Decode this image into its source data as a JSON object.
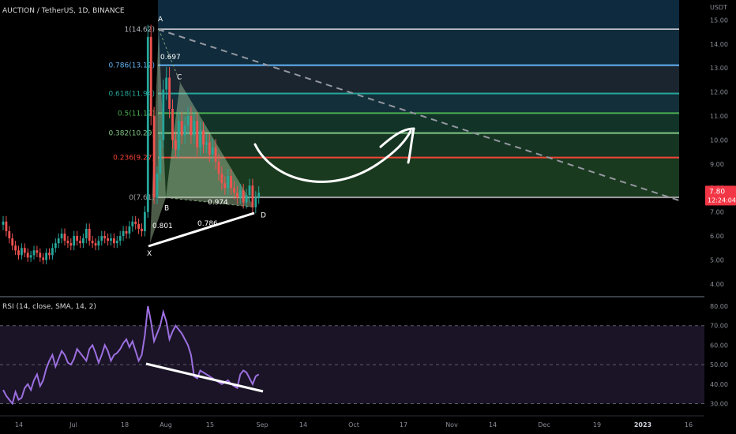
{
  "header": {
    "symbol": "AUCTION / TetherUS, 1D, BINANCE"
  },
  "rsi_header": "RSI (14, close, SMA, 14, 2)",
  "price_axis": {
    "unit": "USDT",
    "ticks": [
      "15.00",
      "14.00",
      "13.00",
      "12.00",
      "11.00",
      "10.00",
      "9.00",
      "8.00",
      "7.00",
      "6.00",
      "5.00",
      "4.00"
    ],
    "current_price": "7.80",
    "countdown": "12:24:04"
  },
  "rsi_axis": {
    "ticks": [
      "80.00",
      "70.00",
      "60.00",
      "50.00",
      "40.00",
      "30.00"
    ]
  },
  "time_axis": {
    "ticks": [
      "14",
      "Jul",
      "18",
      "Aug",
      "15",
      "Sep",
      "14",
      "Oct",
      "17",
      "Nov",
      "14",
      "Dec",
      "19",
      "2023",
      "16"
    ]
  },
  "fib_levels": [
    {
      "label": "1(14.62)",
      "color": "#b2b5be"
    },
    {
      "label": "0.786(13.12)",
      "color": "#64b5f6"
    },
    {
      "label": "0.618(11.94)",
      "color": "#26a69a"
    },
    {
      "label": "0.5(11.12)",
      "color": "#4caf50"
    },
    {
      "label": "0.382(10.29)",
      "color": "#81c784"
    },
    {
      "label": "0.236(9.27)",
      "color": "#f44336"
    },
    {
      "label": "0(7.61)",
      "color": "#9e9e9e"
    }
  ],
  "pattern": {
    "points": [
      "X",
      "A",
      "B",
      "C",
      "D"
    ],
    "ratios": [
      "0.697",
      "0.801",
      "0.974",
      "0.786"
    ]
  },
  "colors": {
    "up": "#26a69a",
    "down": "#ef5350",
    "rsi_line": "#9c6fe0",
    "price_tag": "#f23645",
    "pattern_fill": "#a9c99f"
  },
  "chart_data": {
    "type": "candlestick",
    "title": "AUCTION / TetherUS, 1D, BINANCE",
    "ylabel": "USDT",
    "ylim": [
      3.8,
      15.5
    ],
    "fibonacci": [
      {
        "ratio": 1,
        "price": 14.62
      },
      {
        "ratio": 0.786,
        "price": 13.12
      },
      {
        "ratio": 0.618,
        "price": 11.94
      },
      {
        "ratio": 0.5,
        "price": 11.12
      },
      {
        "ratio": 0.382,
        "price": 10.29
      },
      {
        "ratio": 0.236,
        "price": 9.27
      },
      {
        "ratio": 0,
        "price": 7.61
      }
    ],
    "harmonic_points": [
      {
        "name": "X",
        "price": 5.7
      },
      {
        "name": "A",
        "price": 14.62
      },
      {
        "name": "B",
        "price": 7.6
      },
      {
        "name": "C",
        "price": 12.4
      },
      {
        "name": "D",
        "price": 7.2
      }
    ],
    "last_price": 7.8,
    "close": [
      6.6,
      6.2,
      5.9,
      5.6,
      5.4,
      5.2,
      5.5,
      5.3,
      5.1,
      5.2,
      5.4,
      5.3,
      5.1,
      5.0,
      5.3,
      5.2,
      5.5,
      5.7,
      5.9,
      6.1,
      5.8,
      5.7,
      5.6,
      6.0,
      5.8,
      5.7,
      5.9,
      6.3,
      5.8,
      5.7,
      5.6,
      5.8,
      6.0,
      5.9,
      5.8,
      5.9,
      5.7,
      5.8,
      6.0,
      6.2,
      6.1,
      6.4,
      6.6,
      6.5,
      6.3,
      6.2,
      7.0,
      14.3,
      11.0,
      7.6,
      8.6,
      10.0,
      12.1,
      12.6,
      11.3,
      10.0,
      9.6,
      10.8,
      10.2,
      10.6,
      11.0,
      10.2,
      10.8,
      9.7,
      10.4,
      9.8,
      9.9,
      9.4,
      9.7,
      9.1,
      8.6,
      8.2,
      8.0,
      8.5,
      8.0,
      7.8,
      7.6,
      7.9,
      7.4,
      7.7,
      8.1,
      7.2,
      7.6,
      7.8
    ],
    "rsi": {
      "ylim": [
        27,
        82
      ],
      "levels": [
        70,
        50,
        30
      ],
      "values": [
        37,
        34,
        32,
        30,
        36,
        32,
        33,
        38,
        40,
        37,
        42,
        45,
        39,
        42,
        48,
        52,
        55,
        49,
        53,
        57,
        55,
        51,
        50,
        53,
        58,
        56,
        54,
        52,
        58,
        60,
        56,
        51,
        55,
        60,
        57,
        52,
        55,
        56,
        58,
        61,
        63,
        59,
        62,
        57,
        52,
        55,
        65,
        80,
        72,
        62,
        66,
        70,
        77,
        72,
        63,
        67,
        70,
        68,
        66,
        63,
        60,
        55,
        44,
        43,
        47,
        46,
        45,
        44,
        43,
        42,
        41,
        40,
        41,
        42,
        40,
        39,
        38,
        45,
        47,
        46,
        43,
        40,
        44,
        45
      ]
    },
    "x_ticks": [
      "14",
      "Jul",
      "18",
      "Aug",
      "15",
      "Sep",
      "14",
      "Oct",
      "17",
      "Nov",
      "14",
      "Dec",
      "19",
      "2023",
      "16"
    ]
  }
}
